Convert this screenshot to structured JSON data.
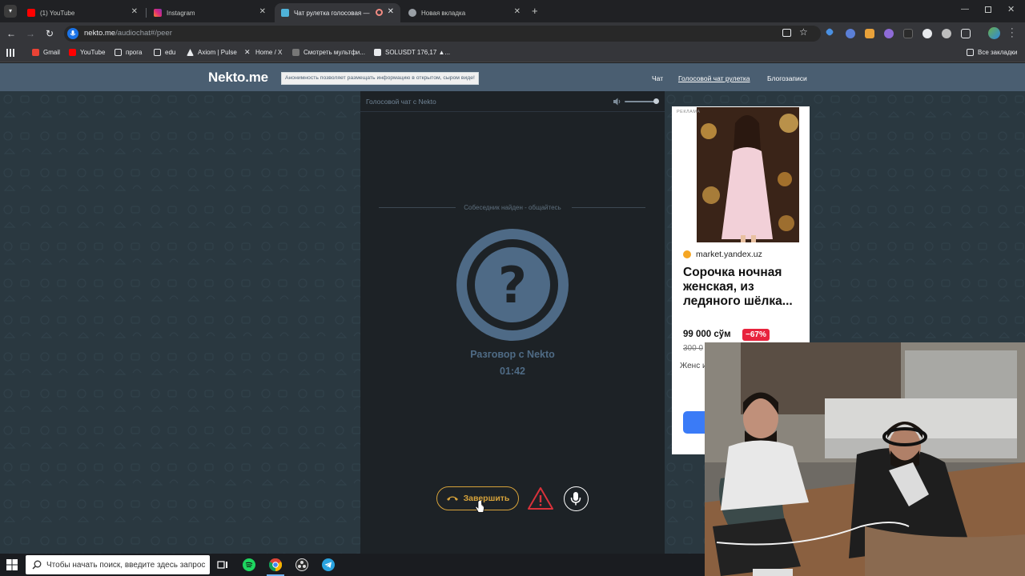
{
  "browser": {
    "tabs": [
      {
        "title": "(1) YouTube",
        "favicon_color": "#ff0000"
      },
      {
        "title": "Instagram",
        "favicon_color": "#e1306c"
      },
      {
        "title": "Чат рулетка голосовая —",
        "favicon_color": "#4fb3d9",
        "active": true
      },
      {
        "title": "Новая вкладка",
        "favicon_color": "#9aa0a6"
      }
    ],
    "url_host": "nekto.me",
    "url_path": "/audiochat#/peer",
    "bookmarks": [
      {
        "label": "Gmail",
        "icon": "gmail-icon"
      },
      {
        "label": "YouTube",
        "icon": "youtube-icon"
      },
      {
        "label": "прога",
        "icon": "folder-icon"
      },
      {
        "label": "edu",
        "icon": "folder-icon"
      },
      {
        "label": "Axiom | Pulse",
        "icon": "axiom-icon"
      },
      {
        "label": "Home / X",
        "icon": "x-icon"
      },
      {
        "label": "Смотреть мультфи...",
        "icon": "film-icon"
      },
      {
        "label": "SOLUSDT 176,17 ▲...",
        "icon": "tradingview-icon"
      }
    ],
    "all_bookmarks_label": "Все закладки"
  },
  "site": {
    "logo": "Nekto.me",
    "notice": "Анонимность позволяет размещать информацию в открытом, сыром виде!",
    "nav": [
      {
        "label": "Чат",
        "current": false
      },
      {
        "label": "Голосовой чат рулетка",
        "current": true
      },
      {
        "label": "Блогозаписи",
        "current": false
      }
    ]
  },
  "chat": {
    "title": "Голосовой чат с Nekto",
    "status": "Собеседник найден - общайтесь",
    "conversation_label": "Разговор с Nekto",
    "timer": "01:42",
    "end_button": "Завершить",
    "colors": {
      "accent": "#d6a23a",
      "avatar": "#4e6a86",
      "warning": "#d9323b"
    }
  },
  "ad": {
    "label": "РЕКЛАМА",
    "domain": "market.yandex.uz",
    "title": "Сорочка ночная женская, из ледяного шёлка...",
    "price": "99 000 сўм",
    "discount": "−67%",
    "old_price": "300 0",
    "description": "Женс из лед летня сороч"
  },
  "taskbar": {
    "search_placeholder": "Чтобы начать поиск, введите здесь запрос"
  }
}
